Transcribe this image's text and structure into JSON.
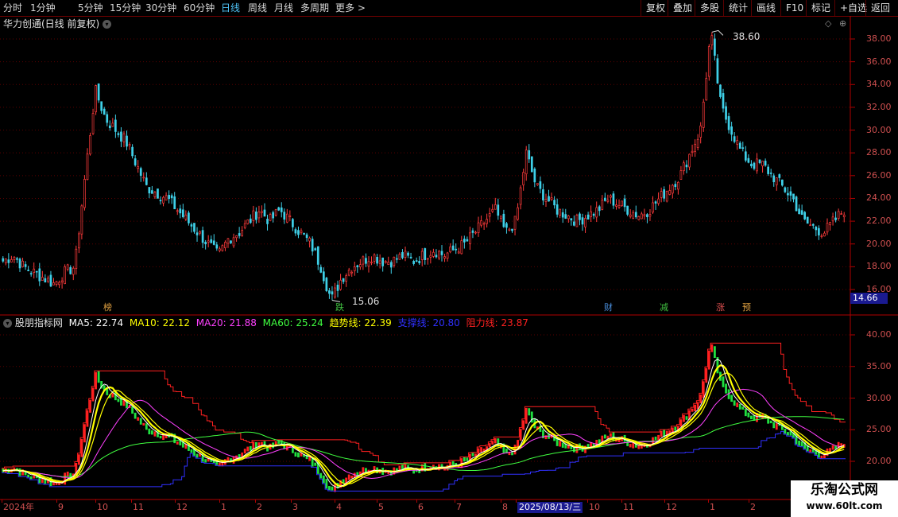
{
  "toolbar": {
    "periods": [
      "分时",
      "1分钟",
      "5分钟",
      "15分钟",
      "30分钟",
      "60分钟",
      "日线",
      "周线",
      "月线",
      "多周期",
      "更多 >"
    ],
    "active_period": "日线",
    "right": [
      "复权",
      "叠加",
      "多股",
      "统计",
      "画线",
      "F10",
      "+自选",
      "返回"
    ]
  },
  "main_panel": {
    "title": "华力创通(日线 前复权)",
    "max_label": "38.60",
    "min_label": "15.06",
    "current_price_box": "14.66",
    "axis_ticks": [
      "38.00",
      "36.00",
      "34.00",
      "32.00",
      "30.00",
      "28.00",
      "26.00",
      "24.00",
      "22.00",
      "20.00",
      "18.00",
      "16.00"
    ],
    "markers": [
      {
        "text": "榜",
        "color": "#e0a040"
      },
      {
        "text": "跌",
        "color": "#40c040"
      },
      {
        "text": "财",
        "color": "#4a90e0"
      },
      {
        "text": "减",
        "color": "#40c040"
      },
      {
        "text": "涨",
        "color": "#e05050"
      },
      {
        "text": "预",
        "color": "#e0a040"
      }
    ]
  },
  "indicator_panel": {
    "name": "股朋指标网",
    "values": [
      {
        "label": "MA5: 22.74",
        "color": "#ffffff"
      },
      {
        "label": "MA10: 22.12",
        "color": "#ffff00"
      },
      {
        "label": "MA20: 21.88",
        "color": "#ff40ff"
      },
      {
        "label": "MA60: 25.24",
        "color": "#40ff40"
      },
      {
        "label": "趋势线: 22.39",
        "color": "#ffff00"
      },
      {
        "label": "支撑线: 20.80",
        "color": "#3030ff"
      },
      {
        "label": "阻力线: 23.87",
        "color": "#ff2020"
      }
    ],
    "axis_ticks": [
      "40.00",
      "35.00",
      "30.00",
      "25.00",
      "20.00"
    ]
  },
  "date_axis": {
    "labels": [
      "2024年",
      "9",
      "10",
      "11",
      "12",
      "1",
      "2",
      "3",
      "4",
      "5",
      "6",
      "7",
      "8",
      "2025/08/13/三",
      "10",
      "11",
      "12",
      "1",
      "2"
    ],
    "highlight": "2025/08/13/三"
  },
  "watermark": {
    "line1": "乐淘公式网",
    "line2": "www.60lt.com"
  },
  "chart_data": {
    "type": "candlestick",
    "main_ylim": [
      15,
      39
    ],
    "indicator_ylim": [
      18,
      41
    ],
    "price_max": 38.6,
    "price_min": 15.06,
    "approx_close_path": [
      18.5,
      19,
      18,
      17.5,
      17,
      16.5,
      17.5,
      18,
      26,
      33.5,
      31,
      30,
      29,
      27,
      25,
      24.5,
      24,
      23,
      22,
      21,
      20,
      19,
      20.5,
      21,
      22,
      23,
      22,
      23,
      22,
      21,
      20,
      18,
      15.06,
      17,
      18,
      18.5,
      19,
      18.5,
      18.5,
      19,
      18.5,
      19,
      19.5,
      19,
      19.5,
      20,
      21,
      22,
      23,
      21,
      22,
      28,
      25,
      24,
      23,
      22.5,
      22,
      22.5,
      23,
      24,
      23.5,
      23,
      22.5,
      23,
      24,
      25,
      26,
      28,
      30,
      38.6,
      32,
      30,
      28,
      27,
      27,
      26,
      25,
      24,
      22,
      21.5,
      21,
      22,
      23
    ]
  }
}
